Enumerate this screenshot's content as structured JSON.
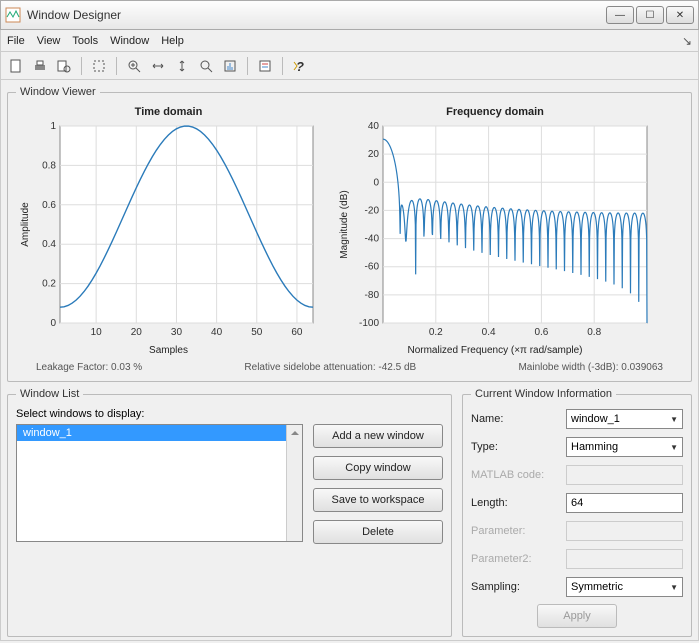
{
  "title": "Window Designer",
  "menu": [
    "File",
    "View",
    "Tools",
    "Window",
    "Help"
  ],
  "viewer": {
    "legend": "Window Viewer",
    "time_title": "Time domain",
    "freq_title": "Frequency domain",
    "time_xlabel": "Samples",
    "time_ylabel": "Amplitude",
    "freq_xlabel": "Normalized Frequency  (×π rad/sample)",
    "freq_ylabel": "Magnitude (dB)",
    "stat_leakage": "Leakage Factor: 0.03 %",
    "stat_sidelobe": "Relative sidelobe attenuation: -42.5 dB",
    "stat_mainlobe": "Mainlobe width (-3dB): 0.039063"
  },
  "list": {
    "legend": "Window List",
    "instruction": "Select windows to display:",
    "items": [
      "window_1"
    ],
    "btn_add": "Add a new window",
    "btn_copy": "Copy window",
    "btn_save": "Save to workspace",
    "btn_delete": "Delete"
  },
  "info": {
    "legend": "Current Window Information",
    "name_label": "Name:",
    "name_value": "window_1",
    "type_label": "Type:",
    "type_value": "Hamming",
    "code_label": "MATLAB code:",
    "length_label": "Length:",
    "length_value": "64",
    "param_label": "Parameter:",
    "param2_label": "Parameter2:",
    "sampling_label": "Sampling:",
    "sampling_value": "Symmetric",
    "apply": "Apply"
  },
  "chart_data": [
    {
      "type": "line",
      "title": "Time domain",
      "xlabel": "Samples",
      "ylabel": "Amplitude",
      "xlim": [
        0,
        64
      ],
      "ylim": [
        0,
        1
      ],
      "xticks": [
        10,
        20,
        30,
        40,
        50,
        60
      ],
      "yticks": [
        0,
        0.2,
        0.4,
        0.6,
        0.8,
        1
      ],
      "series": [
        {
          "name": "window_1",
          "note": "Hamming window N=64, amplitude 0.08→1.0→0.08, peak centered ~31.5"
        }
      ]
    },
    {
      "type": "line",
      "title": "Frequency domain",
      "xlabel": "Normalized Frequency (×π rad/sample)",
      "ylabel": "Magnitude (dB)",
      "xlim": [
        0,
        1
      ],
      "ylim": [
        -100,
        40
      ],
      "xticks": [
        0.2,
        0.4,
        0.6,
        0.8
      ],
      "yticks": [
        -100,
        -80,
        -60,
        -40,
        -20,
        0,
        20,
        40
      ],
      "series": [
        {
          "name": "window_1",
          "note": "Hamming magnitude response: mainlobe ~33dB at 0, first sidelobe ~-42.5dB, oscillating sidelobes decaying toward -30dB with deep nulls"
        }
      ]
    }
  ]
}
